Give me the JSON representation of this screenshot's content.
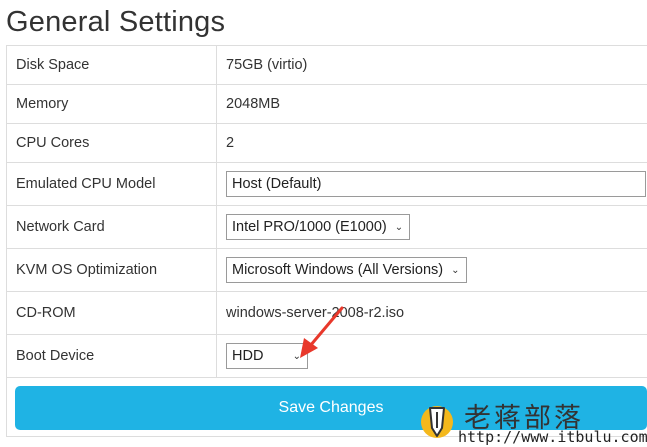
{
  "page": {
    "title": "General Settings"
  },
  "settings": {
    "disk_space": {
      "label": "Disk Space",
      "value": "75GB (virtio)"
    },
    "memory": {
      "label": "Memory",
      "value": "2048MB"
    },
    "cpu_cores": {
      "label": "CPU Cores",
      "value": "2"
    },
    "cpu_model": {
      "label": "Emulated CPU Model",
      "selected": "Host (Default)"
    },
    "network_card": {
      "label": "Network Card",
      "selected": "Intel PRO/1000 (E1000)"
    },
    "os_optimization": {
      "label": "KVM OS Optimization",
      "selected": "Microsoft Windows (All Versions)"
    },
    "cdrom": {
      "label": "CD-ROM",
      "value": "windows-server-2008-r2.iso"
    },
    "boot_device": {
      "label": "Boot Device",
      "selected": "HDD"
    }
  },
  "actions": {
    "save_label": "Save Changes"
  },
  "overlay": {
    "arrow_color": "#e8382b"
  },
  "watermark": {
    "name": "老蒋部落",
    "url": "http://www.itbulu.com"
  },
  "colors": {
    "accent": "#1fb3e4",
    "logo": "#f4b81c"
  }
}
